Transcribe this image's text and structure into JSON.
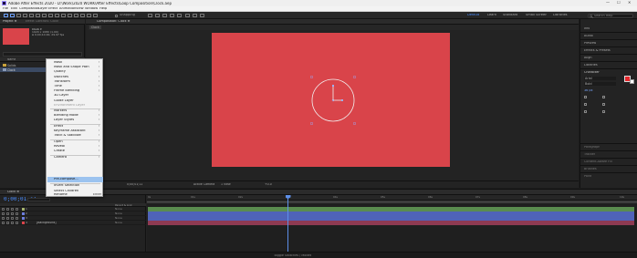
{
  "window": {
    "title": "Adobe After Effects 2020 - D:\\Work\\2020 WORK\\After Effects\\Loop Composition\\Clock.aep",
    "controls": [
      "—",
      "☐",
      "✕"
    ]
  },
  "menubar": {
    "items": [
      "File",
      "Edit",
      "Composition",
      "Layer",
      "Effect",
      "Animation",
      "View",
      "Window",
      "Help"
    ]
  },
  "toolbar": {
    "snapping_label": "Snapping",
    "workspaces": [
      "Default",
      "Learn",
      "Standard",
      "Small Screen",
      "Libraries"
    ],
    "search_placeholder": "Search Help"
  },
  "project_panel": {
    "tabs": [
      "Project ≡",
      "Effect Controls: Clock"
    ],
    "comp_name": "Clock ▾",
    "comp_info": [
      "1920 x 1080 (1.00)",
      "Δ 0;00;10;00, 29.97 fps"
    ],
    "columns": [
      "Name",
      "Type"
    ],
    "rows": [
      {
        "name": "Solids",
        "selected": false
      },
      {
        "name": "Clock",
        "selected": true
      }
    ]
  },
  "comp_panel": {
    "tabs": [
      "Composition: Clock ≡",
      "Clock"
    ],
    "canvas_color": "#d9444a",
    "footer": [
      "(50%)",
      "0;00;01;11",
      "Active Camera",
      "1 View",
      "+0.0"
    ]
  },
  "right_panel": {
    "items": [
      "Info",
      "Audio",
      "Preview",
      "Effects & Presets",
      "Align",
      "Libraries",
      "Character",
      "Arial",
      "Bold",
      "Paragraph",
      "Tracker",
      "Content-Aware Fill",
      "Brushes",
      "Paint"
    ],
    "font_size": "36 px",
    "fill_color": "#e5262b"
  },
  "context_menu": {
    "items": [
      {
        "label": "Mask",
        "arrow": true,
        "disabled": false
      },
      {
        "label": "Mask and Shape Path",
        "arrow": true,
        "disabled": false
      },
      {
        "label": "Quality",
        "arrow": true,
        "disabled": false
      },
      {
        "label": "Switches",
        "arrow": true,
        "disabled": false
      },
      {
        "label": "Transform",
        "arrow": true,
        "disabled": false
      },
      {
        "label": "Time",
        "arrow": true,
        "disabled": false
      },
      {
        "label": "Frame Blending",
        "arrow": true,
        "disabled": false
      },
      {
        "label": "3D Layer",
        "arrow": false,
        "disabled": false
      },
      {
        "label": "Guide Layer",
        "arrow": false,
        "disabled": false
      },
      {
        "label": "Environment Layer",
        "arrow": false,
        "disabled": true
      },
      {
        "label": "Markers",
        "arrow": true,
        "disabled": false
      },
      {
        "label": "Blending Mode",
        "arrow": true,
        "disabled": false
      },
      {
        "label": "Layer Styles",
        "arrow": true,
        "disabled": false
      },
      {
        "label": "Effect",
        "arrow": true,
        "disabled": false
      },
      {
        "label": "Keyframe Assistant",
        "arrow": true,
        "disabled": false
      },
      {
        "label": "Track & Stabilize",
        "arrow": true,
        "disabled": false
      },
      {
        "label": "Open",
        "arrow": true,
        "disabled": false
      },
      {
        "label": "Reveal",
        "arrow": true,
        "disabled": false
      },
      {
        "label": "Create",
        "arrow": true,
        "disabled": false
      },
      {
        "label": "Camera",
        "arrow": true,
        "disabled": false
      },
      {
        "label": "Pre-compose...",
        "arrow": false,
        "disabled": false,
        "highlighted": true
      },
      {
        "label": "Invert Selection",
        "arrow": false,
        "disabled": false
      },
      {
        "label": "Select Children",
        "arrow": false,
        "disabled": false
      },
      {
        "label": "Rename",
        "arrow": false,
        "disabled": false,
        "shortcut": "Enter"
      }
    ]
  },
  "timeline": {
    "tab": "Clock ≡",
    "timecode": "0;00;01;11",
    "ruler_ticks": [
      "0s",
      "01s",
      "02s",
      "03s",
      "04s",
      "05s",
      "06s",
      "07s",
      "08s",
      "09s",
      "10s"
    ],
    "column_label": "Parent & Link",
    "layers": [
      {
        "num": "1",
        "name": "",
        "color": "#a4b36d",
        "parent": "None",
        "bar": "#5a8c4f"
      },
      {
        "num": "2",
        "name": "",
        "color": "#6c7ddc",
        "parent": "None",
        "bar": "#4f63b8"
      },
      {
        "num": "3",
        "name": "",
        "color": "#6c7ddc",
        "parent": "None",
        "bar": "#4f63b8"
      },
      {
        "num": "4",
        "name": "[Background]",
        "color": "#d9444a",
        "parent": "None",
        "bar": "#8e3a52"
      }
    ]
  },
  "status": {
    "text": "Toggle Switches / Modes"
  }
}
